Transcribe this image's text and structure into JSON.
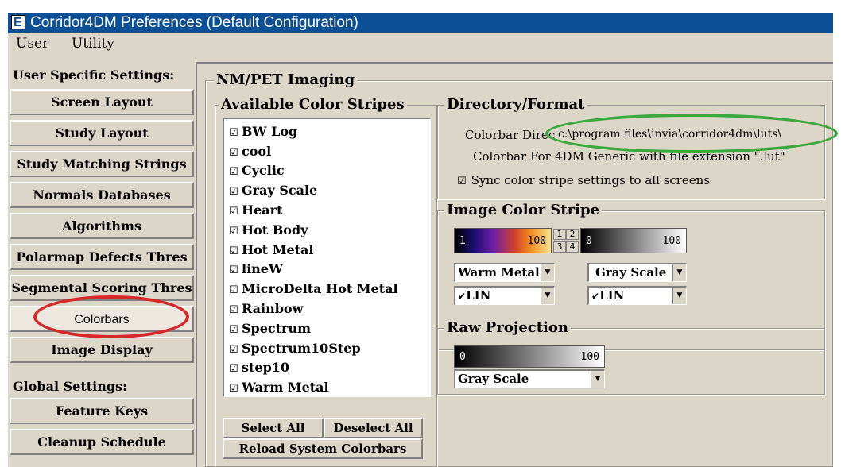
{
  "window": {
    "title": "Corridor4DM Preferences (Default Configuration)"
  },
  "menu": {
    "items": [
      "User",
      "Utility"
    ]
  },
  "sidebar": {
    "user_heading": "User Specific Settings:",
    "user_items": [
      "Screen Layout",
      "Study Layout",
      "Study Matching Strings",
      "Normals Databases",
      "Algorithms",
      "Polarmap Defects Thres",
      "Segmental Scoring Thres",
      "Colorbars",
      "Image Display"
    ],
    "selected": "Colorbars",
    "global_heading": "Global Settings:",
    "global_items": [
      "Feature Keys",
      "Cleanup Schedule"
    ]
  },
  "panel": {
    "title": "NM/PET Imaging",
    "stripes": {
      "title": "Available Color Stripes",
      "items": [
        "BW Log",
        "cool",
        "Cyclic",
        "Gray Scale",
        "Heart",
        "Hot Body",
        "Hot Metal",
        "lineW",
        "MicroDelta Hot Metal",
        "Rainbow",
        "Spectrum",
        "Spectrum10Step",
        "step10",
        "Warm Metal"
      ],
      "select_all": "Select All",
      "deselect_all": "Deselect All",
      "reload": "Reload System Colorbars"
    },
    "directory": {
      "title": "Directory/Format",
      "dir_label": "Colorbar Direc",
      "dir_value": "c:\\program files\\invia\\corridor4dm\\luts\\",
      "format_label": "Colorbar For",
      "format_value": "4DM Generic with file extension \".lut\"",
      "sync_label": "Sync color stripe settings to all screens"
    },
    "image_stripe": {
      "title": "Image Color Stripe",
      "left": {
        "min": "1",
        "max": "100",
        "stripe": "Warm Metal",
        "scale": "LIN"
      },
      "right": {
        "min": "0",
        "max": "100",
        "stripe": "Gray Scale",
        "scale": "LIN"
      },
      "layout": [
        "1",
        "2",
        "3",
        "4"
      ]
    },
    "raw": {
      "title": "Raw Projection",
      "min": "0",
      "max": "100",
      "stripe": "Gray Scale"
    }
  },
  "check_mark": "☑",
  "lin_check": "✔",
  "arrow_glyph": "▼",
  "colors": {
    "titlebar": "#0b4f97",
    "frame": "#dcd6c9",
    "highlight_red": "#d62828",
    "highlight_green": "#3aa83a"
  }
}
